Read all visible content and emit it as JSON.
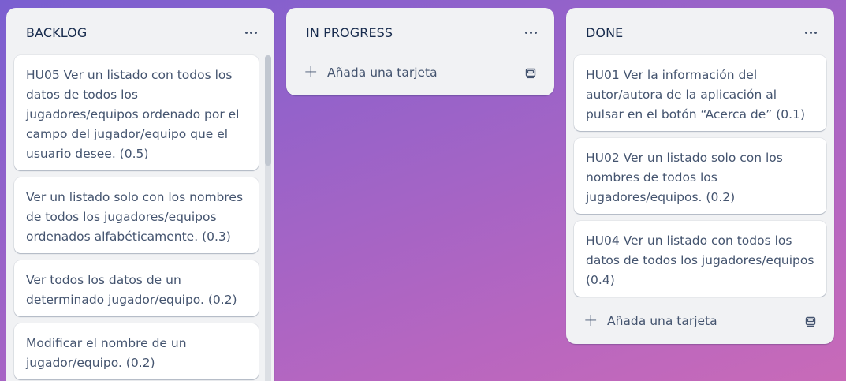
{
  "board": {
    "lists": [
      {
        "title": "BACKLOG",
        "cards": [
          "HU05 Ver un listado con todos los datos de todos los jugadores/equipos ordenado por el campo del jugador/equipo que el usuario desee. (0.5)",
          "Ver un listado solo con los nombres de todos los jugadores/equipos ordenados alfabéticamente. (0.3)",
          "Ver todos los datos de un determinado jugador/equipo. (0.2)",
          "Modificar el nombre de un jugador/equipo. (0.2)"
        ]
      },
      {
        "title": "IN PROGRESS",
        "add_card_label": "Añada una tarjeta"
      },
      {
        "title": "DONE",
        "cards": [
          "HU01 Ver la información del autor/autora de la aplicación al pulsar en el botón “Acerca de” (0.1)",
          "HU02 Ver un listado solo con los nombres de todos los jugadores/equipos. (0.2)",
          "HU04 Ver un listado con todos los datos de todos los jugadores/equipos (0.4)"
        ],
        "add_card_label": "Añada una tarjeta"
      }
    ]
  },
  "icons": {
    "list_menu": "more-horizontal-icon",
    "add": "plus-icon",
    "template": "card-template-icon"
  },
  "colors": {
    "background_start": "#7a5fd0",
    "background_end": "#c86ab8",
    "list_bg": "#f1f2f4",
    "card_bg": "#ffffff",
    "text": "#44546f",
    "title": "#172b4d"
  }
}
